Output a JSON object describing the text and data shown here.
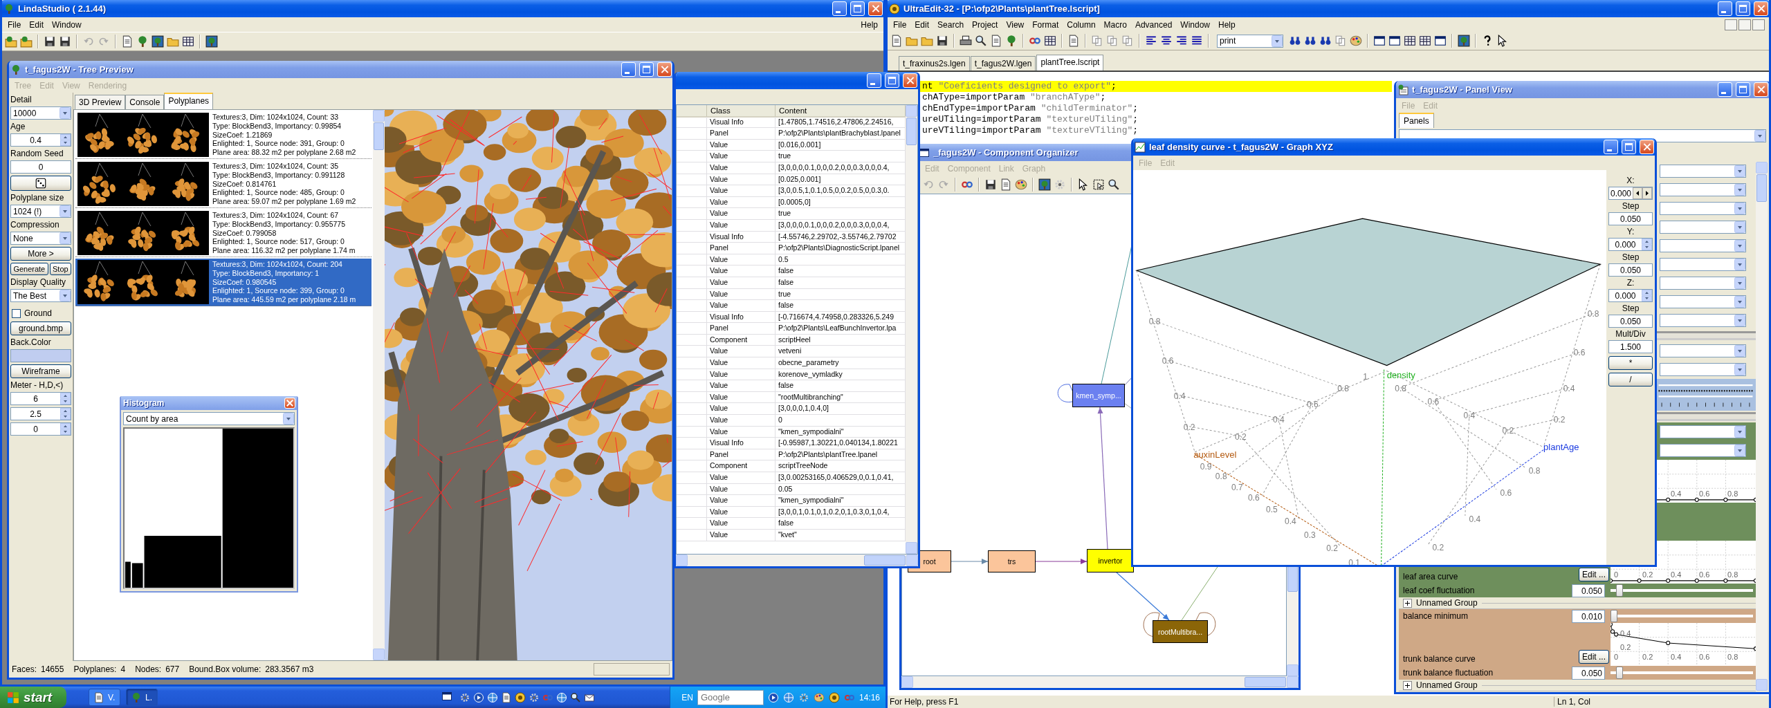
{
  "linda_studio": {
    "title": "LindaStudio ( 2.1.44)",
    "menu": [
      {
        "label": "File",
        "disabled": false
      },
      {
        "label": "Edit",
        "disabled": false
      },
      {
        "label": "Window",
        "disabled": false
      }
    ],
    "help_menu": [
      {
        "label": "Help",
        "disabled": false
      }
    ],
    "tree_preview": {
      "title": "t_fagus2W - Tree Preview",
      "menu": [
        {
          "label": "Tree",
          "disabled": true
        },
        {
          "label": "Edit",
          "disabled": true
        },
        {
          "label": "View",
          "disabled": true
        },
        {
          "label": "Rendering",
          "disabled": true
        }
      ],
      "controls": [
        {
          "kind": "label",
          "text": "Detail"
        },
        {
          "kind": "combo",
          "value": "10000"
        },
        {
          "kind": "label",
          "text": "Age"
        },
        {
          "kind": "spin",
          "value": "0.4"
        },
        {
          "kind": "label",
          "text": "Random Seed"
        },
        {
          "kind": "field",
          "value": "0"
        },
        {
          "kind": "dice"
        },
        {
          "kind": "label",
          "text": "Polyplane size"
        },
        {
          "kind": "combo",
          "value": "1024 (!)"
        },
        {
          "kind": "label",
          "text": "Compression"
        },
        {
          "kind": "combo",
          "value": "None"
        },
        {
          "kind": "button",
          "label": "More >"
        },
        {
          "kind": "button_pair",
          "labels": [
            "Generate",
            "Stop"
          ]
        },
        {
          "kind": "label",
          "text": "Display Quality"
        },
        {
          "kind": "combo",
          "value": "The Best"
        },
        {
          "kind": "checkbox",
          "label": "Ground",
          "checked": false
        },
        {
          "kind": "button",
          "label": "ground.bmp"
        },
        {
          "kind": "label",
          "text": "Back.Color"
        },
        {
          "kind": "swatch"
        },
        {
          "kind": "button",
          "label": "Wireframe"
        },
        {
          "kind": "label",
          "text": "Meter - H,D,<)"
        },
        {
          "kind": "spin",
          "value": "6"
        },
        {
          "kind": "spin",
          "value": "2.5"
        },
        {
          "kind": "spin",
          "value": "0"
        }
      ],
      "tabs": [
        {
          "label": "3D Preview",
          "selected": false
        },
        {
          "label": "Console",
          "selected": false
        },
        {
          "label": "Polyplanes",
          "selected": true
        }
      ],
      "polyplanes": [
        {
          "selected": false,
          "lines": [
            "Textures:3, Dim: 1024x1024, Count: 33",
            "Type: BlockBend3, Importancy: 0.99854",
            "SizeCoef: 1.21869",
            "Enlighted: 1, Source node: 391, Group: 0",
            "Plane area: 88.32 m2 per polyplane 2.68 m2"
          ]
        },
        {
          "selected": false,
          "lines": [
            "Textures:3, Dim: 1024x1024, Count: 35",
            "Type: BlockBend3, Importancy: 0.991128",
            "SizeCoef: 0.814761",
            "Enlighted: 1, Source node: 485, Group: 0",
            "Plane area: 59.07 m2 per polyplane 1.69 m2"
          ]
        },
        {
          "selected": false,
          "lines": [
            "Textures:3, Dim: 1024x1024, Count: 67",
            "Type: BlockBend3, Importancy: 0.955775",
            "SizeCoef: 0.799058",
            "Enlighted: 1, Source node: 517, Group: 0",
            "Plane area: 116.32 m2 per polyplane 1.74 m"
          ]
        },
        {
          "selected": true,
          "lines": [
            "Textures:3, Dim: 1024x1024, Count: 204",
            "Type: BlockBend3, Importancy: 1",
            "SizeCoef: 0.980545",
            "Enlighted: 1, Source node: 399, Group: 0",
            "Plane area: 445.59 m2 per polyplane 2.18 m"
          ]
        }
      ],
      "status_bar": [
        {
          "label": "Faces:",
          "value": "14655"
        },
        {
          "label": "Polyplanes:",
          "value": "4"
        },
        {
          "label": "Nodes:",
          "value": "677"
        },
        {
          "label": "Bound.Box volume:",
          "value": "283.3567 m3"
        }
      ]
    }
  },
  "histogram": {
    "title": "Histogram",
    "mode": "Count by area"
  },
  "property_table": {
    "columns": [
      "Class",
      "Content"
    ],
    "rows": [
      {
        "class": "Visual Info",
        "content": "[1.47805,1.74516,2.47806,2.24516,"
      },
      {
        "class": "Panel",
        "content": "P:\\ofp2\\Plants\\plantBrachyblast.lpanel"
      },
      {
        "class": "Value",
        "content": "[0.016,0.001]"
      },
      {
        "class": "Value",
        "content": "true"
      },
      {
        "class": "Value",
        "content": "[3,0,0,0,0.1,0,0,0.2,0,0,0.3,0,0,0.4,"
      },
      {
        "class": "Value",
        "content": "[0.025,0.001]"
      },
      {
        "class": "Value",
        "content": "[3,0,0.5,1,0.1,0.5,0,0.2,0.5,0,0.3,0."
      },
      {
        "class": "Value",
        "content": "[0.0005,0]"
      },
      {
        "class": "Value",
        "content": "true"
      },
      {
        "class": "Value",
        "content": "[3,0,0,0,0.1,0,0,0.2,0,0,0.3,0,0,0.4,"
      },
      {
        "class": "Visual Info",
        "content": "[-4.55746,2.29702,-3.55746,2.79702"
      },
      {
        "class": "Panel",
        "content": "P:\\ofp2\\Plants\\DiagnosticScript.lpanel"
      },
      {
        "class": "Value",
        "content": "0.5"
      },
      {
        "class": "Value",
        "content": "false"
      },
      {
        "class": "Value",
        "content": "false"
      },
      {
        "class": "Value",
        "content": "true"
      },
      {
        "class": "Value",
        "content": "false"
      },
      {
        "class": "Visual Info",
        "content": "[-0.716674,4.74958,0.283326,5.249"
      },
      {
        "class": "Panel",
        "content": "P:\\ofp2\\Plants\\LeafBunchInvertor.lpa"
      },
      {
        "class": "Component",
        "content": "scriptHeel"
      },
      {
        "class": "Value",
        "content": "vetveni"
      },
      {
        "class": "Value",
        "content": "obecne_parametry"
      },
      {
        "class": "Value",
        "content": "korenove_vymladky"
      },
      {
        "class": "Value",
        "content": "false"
      },
      {
        "class": "Value",
        "content": "\"rootMultibranching\""
      },
      {
        "class": "Value",
        "content": "[3,0,0,0,1,0.4,0]"
      },
      {
        "class": "Value",
        "content": "0"
      },
      {
        "class": "Value",
        "content": "\"kmen_sympodialni\""
      },
      {
        "class": "Visual Info",
        "content": "[-0.95987,1.30221,0.040134,1.80221"
      },
      {
        "class": "Panel",
        "content": "P:\\ofp2\\Plants\\plantTree.lpanel"
      },
      {
        "class": "Component",
        "content": "scriptTreeNode"
      },
      {
        "class": "Value",
        "content": "[3,0.00253165,0.406529,0,0.1,0.41,"
      },
      {
        "class": "Value",
        "content": "0.05"
      },
      {
        "class": "Value",
        "content": "\"kmen_sympodialni\""
      },
      {
        "class": "Value",
        "content": "[3,0,0,1,0.1,0,1,0.2,0,1,0.3,0,1,0.4,"
      },
      {
        "class": "Value",
        "content": "false"
      },
      {
        "class": "Value",
        "content": "\"kvet\""
      }
    ]
  },
  "ultraedit": {
    "title": "UltraEdit-32 - [P:\\ofp2\\Plants\\plantTree.lscript]",
    "menu": [
      {
        "label": "File",
        "disabled": false
      },
      {
        "label": "Edit",
        "disabled": false
      },
      {
        "label": "Search",
        "disabled": false
      },
      {
        "label": "Project",
        "disabled": false
      },
      {
        "label": "View",
        "disabled": false
      },
      {
        "label": "Format",
        "disabled": false
      },
      {
        "label": "Column",
        "disabled": false
      },
      {
        "label": "Macro",
        "disabled": false
      },
      {
        "label": "Advanced",
        "disabled": false
      },
      {
        "label": "Window",
        "disabled": false
      },
      {
        "label": "Help",
        "disabled": false
      }
    ],
    "find_combo": "print",
    "tabs": [
      {
        "label": "t_fraxinus2s.lgen",
        "selected": false
      },
      {
        "label": "t_fagus2W.lgen",
        "selected": false
      },
      {
        "label": "plantTree.lscript",
        "selected": true
      }
    ],
    "lines": [
      {
        "text": "nt \"Coeficients designed to export\";",
        "current": true
      },
      {
        "text": "chAType=importParam \"branchAType\";",
        "current": false
      },
      {
        "text": "chEndType=importParam \"childTerminator\";",
        "current": false
      },
      {
        "text": "ureUTiling=importParam \"textureUTiling\";",
        "current": false
      },
      {
        "text": "ureVTiling=importParam \"textureVTiling\";",
        "current": false
      }
    ],
    "status_bar": [
      "For Help, press F1",
      "Ln 1, Col"
    ]
  },
  "component_organizer": {
    "title": "_fagus2W - Component Organizer",
    "menu": [
      {
        "label": "Edit",
        "disabled": true
      },
      {
        "label": "Component",
        "disabled": true
      },
      {
        "label": "Link",
        "disabled": true
      },
      {
        "label": "Graph",
        "disabled": true
      }
    ],
    "nodes": [
      {
        "label": "root",
        "color": "#fbc59b"
      },
      {
        "label": "trs",
        "color": "#fbc59b"
      },
      {
        "label": "invertor",
        "color": "#ffff00"
      },
      {
        "label": "kmen_symp...",
        "color": "#6b80f0"
      },
      {
        "label": "rootMultibra...",
        "color": "#8b6508"
      }
    ]
  },
  "graph_xyz": {
    "title": "leaf density curve - t_fagus2W - Graph XYZ",
    "menu": [
      {
        "label": "File",
        "disabled": true
      },
      {
        "label": "Edit",
        "disabled": true
      }
    ],
    "axes": [
      {
        "name": "density",
        "color": "#20b020"
      },
      {
        "name": "auxinLevel",
        "color": "#b45a10"
      },
      {
        "name": "plantAge",
        "color": "#1a3ae0"
      }
    ],
    "tick_labels": {
      "left_wall": [
        "0.8",
        "0.6",
        "0.4",
        "0.2"
      ],
      "floor_middle": [
        "0.8",
        "0.6",
        "0.4",
        "0.2"
      ],
      "floor_back": [
        "1",
        "0.8",
        "0.6",
        "0.4",
        "0.2"
      ],
      "right_wall": [
        "0.8",
        "0.6",
        "0.4",
        "0.2"
      ],
      "auxin_axis": [
        "0.9",
        "0.8",
        "0.7",
        "0.6",
        "0.5",
        "0.4",
        "0.3",
        "0.2",
        "0.1"
      ],
      "plant_age_axis": [
        "0.2",
        "0.4",
        "0.6",
        "0.8"
      ]
    },
    "controls": [
      {
        "kind": "hspin",
        "label": "X:",
        "value": "0.000"
      },
      {
        "kind": "field",
        "label": "Step",
        "value": "0.050"
      },
      {
        "kind": "spin",
        "label": "Y:",
        "value": "0.000"
      },
      {
        "kind": "field",
        "label": "Step",
        "value": "0.050"
      },
      {
        "kind": "spin",
        "label": "Z:",
        "value": "0.000"
      },
      {
        "kind": "field",
        "label": "Step",
        "value": "0.050"
      },
      {
        "kind": "field",
        "label": "Mult/Div",
        "value": "1.500"
      }
    ],
    "buttons": [
      "*",
      "/"
    ]
  },
  "panel_view": {
    "title": "t_fagus2W - Panel View",
    "menu": [
      {
        "label": "File",
        "disabled": true
      },
      {
        "label": "Edit",
        "disabled": true
      }
    ],
    "tabs": [
      {
        "label": "Panels",
        "selected": true
      }
    ],
    "rows": [
      {
        "kind": "combo"
      },
      {
        "kind": "combo"
      },
      {
        "kind": "combo"
      },
      {
        "kind": "combo"
      },
      {
        "kind": "combo"
      },
      {
        "kind": "combo"
      },
      {
        "kind": "combo"
      },
      {
        "kind": "combo"
      },
      {
        "kind": "combo"
      },
      {
        "kind": "bar"
      },
      {
        "kind": "combo"
      },
      {
        "kind": "combo"
      },
      {
        "kind": "ruler",
        "color": "#a9c0e0"
      },
      {
        "kind": "bar"
      },
      {
        "kind": "combo",
        "color": "#6e8f5c"
      },
      {
        "kind": "combo",
        "color": "#6e8f5c"
      },
      {
        "kind": "flat_curve",
        "x_ticks": [
          "0.4",
          "0.6",
          "0.8"
        ]
      },
      {
        "kind": "band",
        "color": "#6e8f5c"
      },
      {
        "kind": "flat_curve",
        "color": "#6e8f5c",
        "label": "leaf area curve",
        "button": "Edit ...",
        "x_ticks": [
          "0",
          "0.2",
          "0.4",
          "0.6",
          "0.8"
        ]
      },
      {
        "kind": "slider",
        "color": "#6e8f5c",
        "label": "leaf coef fluctuation",
        "value": "0.050",
        "level": 0.05
      },
      {
        "kind": "group",
        "label": "Unnamed Group",
        "expanded": false
      },
      {
        "kind": "slider",
        "color": "#cfa886",
        "label": "balance minimum",
        "value": "0.010",
        "level": 0.01
      },
      {
        "kind": "falling_curve",
        "color": "#cfa886",
        "label": "trunk balance curve",
        "button": "Edit ...",
        "y_ticks": [
          "0.4",
          "0.2"
        ],
        "x_ticks": [
          "0",
          "0.2",
          "0.4",
          "0.6",
          "0.8"
        ]
      },
      {
        "kind": "slider",
        "color": "#cfa886",
        "label": "trunk balance fluctuation",
        "value": "0.050",
        "level": 0.05
      },
      {
        "kind": "group",
        "label": "Unnamed Group",
        "expanded": false
      }
    ]
  },
  "taskbar": {
    "start": "start",
    "tasks": [
      {
        "label": "V.",
        "selected": false
      },
      {
        "label": "L.",
        "selected": true
      }
    ],
    "language": "EN",
    "search_placeholder": "Google",
    "clock": "14:16"
  }
}
